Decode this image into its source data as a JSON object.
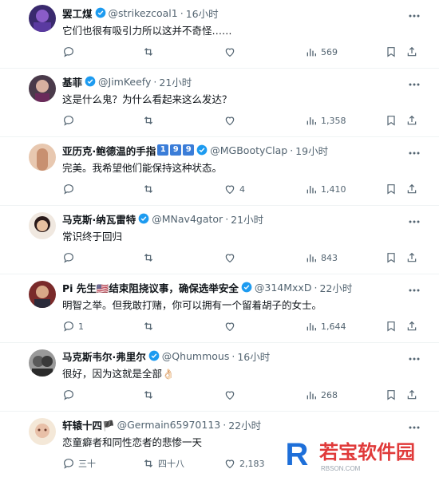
{
  "colors": {
    "icon": "#536471",
    "verified": "#1d9bf0",
    "text": "#0f1419"
  },
  "tweets": [
    {
      "name": "罢工煤",
      "handle": "@strikezcoal1",
      "time": "16小时",
      "text": "它们也很有吸引力所以这并不奇怪……",
      "reply": "",
      "retweet": "",
      "like": "",
      "views": "569"
    },
    {
      "name": "基菲",
      "handle": "@JimKeefy",
      "time": "21小时",
      "text": "这是什么鬼？为什么看起来这么发达？",
      "reply": "",
      "retweet": "",
      "like": "",
      "views": "1,358"
    },
    {
      "name": "亚历克·鲍德温的手指",
      "badges": [
        "1",
        "9",
        "9"
      ],
      "handle": "@MGBootyClap",
      "time": "19小时",
      "text": "完美。我希望他们能保持这种状态。",
      "reply": "",
      "retweet": "",
      "like": "4",
      "views": "1,410"
    },
    {
      "name": "马克斯·纳瓦雷特",
      "handle": "@MNav4gator",
      "time": "21小时",
      "text": "常识终于回归",
      "reply": "",
      "retweet": "",
      "like": "",
      "views": "843"
    },
    {
      "name": "Pi 先生🇺🇸结束阻挠议事，确保选举安全",
      "handle": "@314MxxD",
      "time": "22小时",
      "text": "明智之举。但我敢打赌，你可以拥有一个留着胡子的女士。",
      "reply": "1",
      "retweet": "",
      "like": "",
      "views": "1,644"
    },
    {
      "name": "马克斯韦尔·弗里尔",
      "handle": "@Qhummous",
      "time": "16小时",
      "text": "很好，因为这就是全部👌🏻",
      "reply": "",
      "retweet": "",
      "like": "",
      "views": "268"
    },
    {
      "name": "轩辕十四🏴",
      "handle": "@Germain65970113",
      "time": "22小时",
      "text": "恋童癖者和同性恋者的悲惨一天",
      "reply": "三十",
      "retweet": "四十八",
      "like": "2,183",
      "views": ""
    }
  ],
  "watermark": {
    "title": "若宝软件园",
    "subtitle": "RBSON.COM",
    "logo": "R"
  }
}
